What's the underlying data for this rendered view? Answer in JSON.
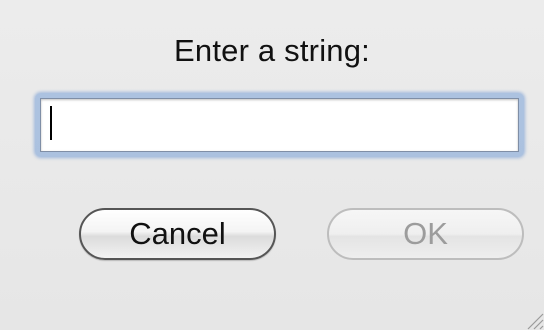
{
  "dialog": {
    "prompt": "Enter a string:",
    "input_value": "",
    "cancel_label": "Cancel",
    "ok_label": "OK",
    "ok_enabled": false
  },
  "colors": {
    "background": "#ececec",
    "focus_ring": "#78a0d7",
    "ok_text_disabled": "#9c9c9c"
  }
}
